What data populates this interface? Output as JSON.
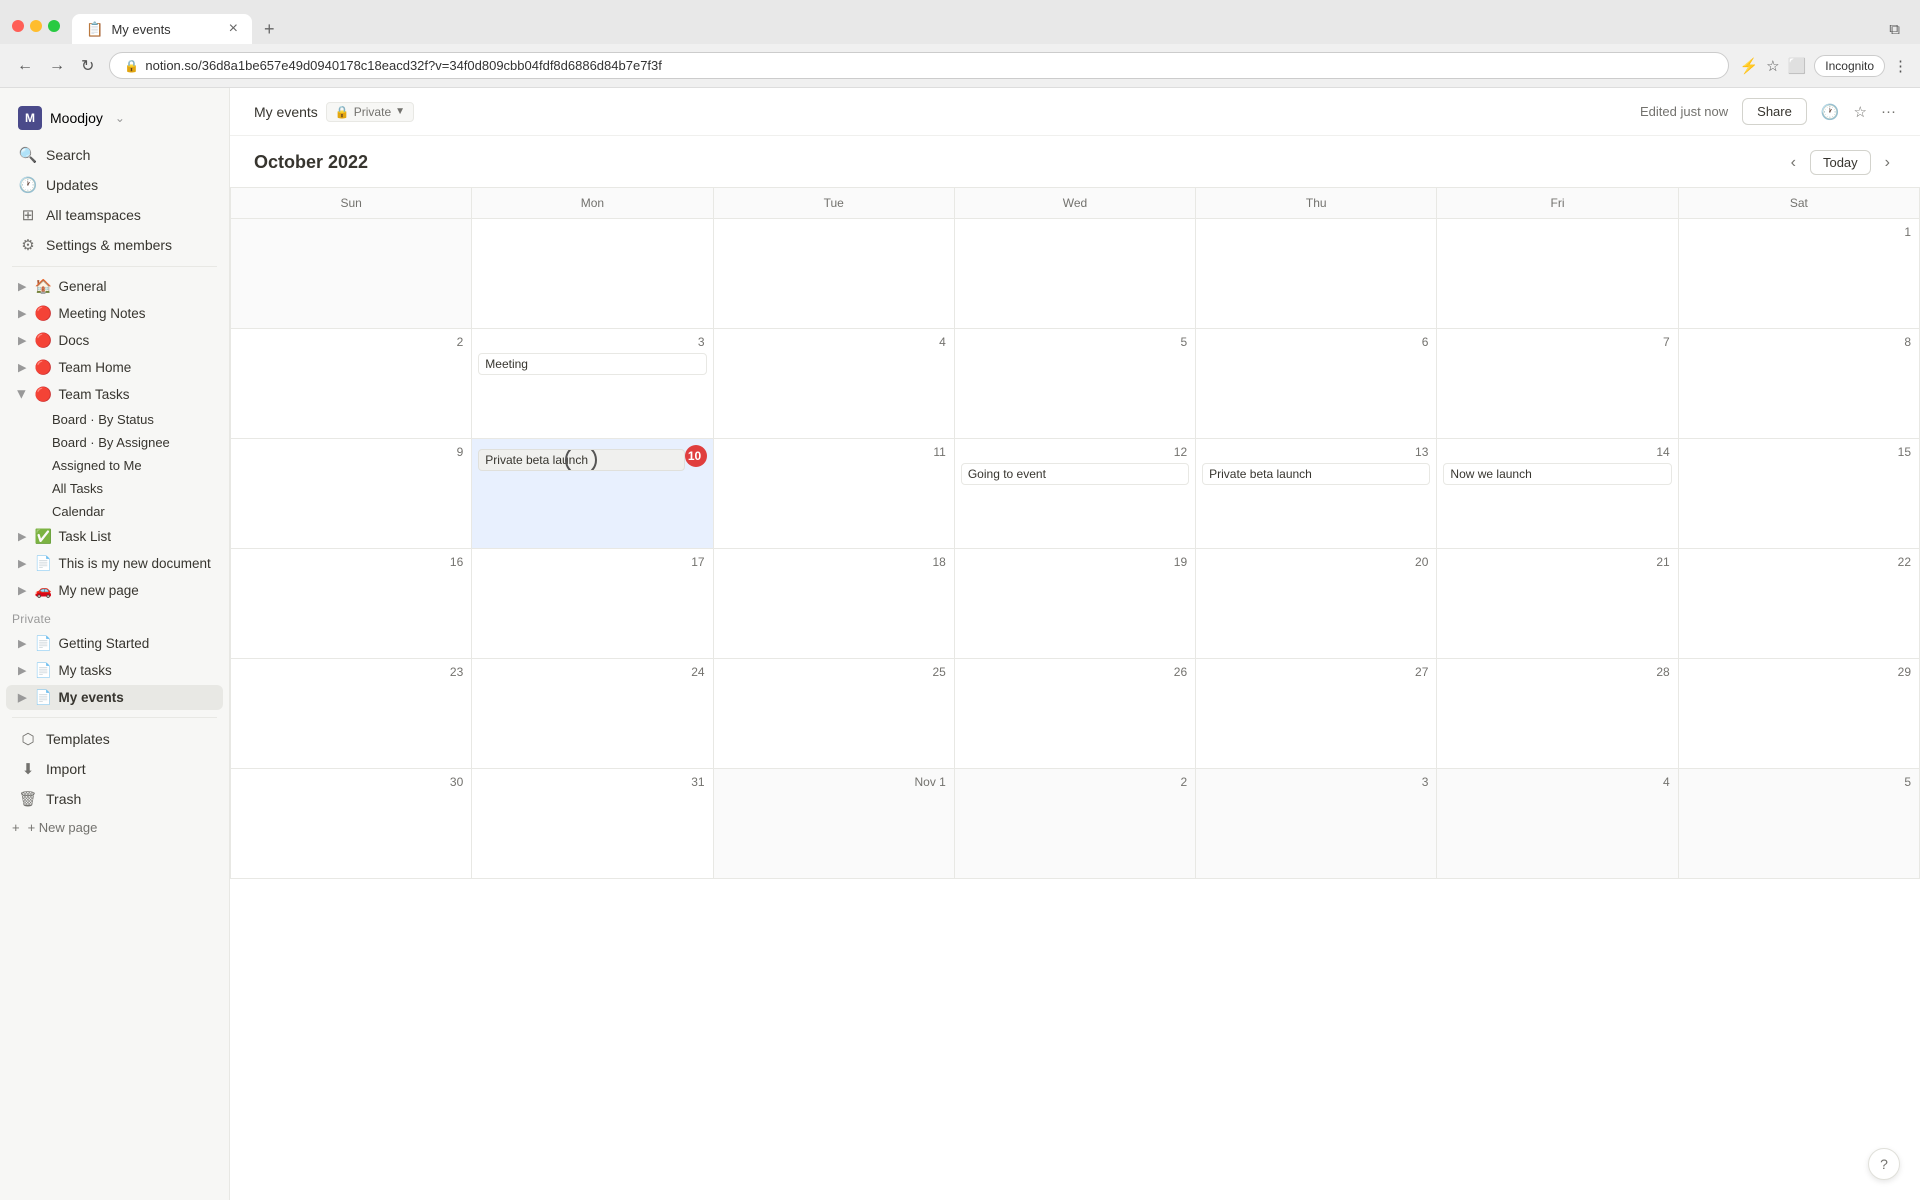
{
  "browser": {
    "tab_title": "My events",
    "tab_icon": "📋",
    "url": "notion.so/36d8a1be657e49d0940178c18eacd32f?v=34f0d809cbb04fdf8d6886d84b7e7f3f",
    "new_tab_label": "+",
    "back_btn": "←",
    "forward_btn": "→",
    "reload_btn": "↻",
    "lock_icon": "🔒",
    "incognito_label": "Incognito",
    "more_btn": "⋮"
  },
  "sidebar": {
    "workspace_name": "Moodjoy",
    "workspace_icon": "M",
    "search_label": "Search",
    "updates_label": "Updates",
    "all_teamspaces_label": "All teamspaces",
    "settings_label": "Settings & members",
    "general_label": "General",
    "general_icon": "🏠",
    "meeting_notes_label": "Meeting Notes",
    "docs_label": "Docs",
    "team_home_label": "Team Home",
    "team_tasks_label": "Team Tasks",
    "board_by_status_label": "Board · By Status",
    "board_by_assignee_label": "Board · By Assignee",
    "assigned_to_me_label": "Assigned to Me",
    "all_tasks_label": "All Tasks",
    "calendar_label": "Calendar",
    "task_list_label": "Task List",
    "new_document_label": "This is my new document",
    "my_new_page_label": "My new page",
    "private_label": "Private",
    "getting_started_label": "Getting Started",
    "my_tasks_label": "My tasks",
    "my_events_label": "My events",
    "templates_label": "Templates",
    "import_label": "Import",
    "trash_label": "Trash",
    "new_page_label": "+ New page"
  },
  "topbar": {
    "page_title": "My events",
    "privacy_label": "Private",
    "edited_label": "Edited just now",
    "share_label": "Share",
    "more_btn": "···"
  },
  "calendar": {
    "month_title": "October 2022",
    "today_btn": "Today",
    "nav_prev": "‹",
    "nav_next": "›",
    "days_of_week": [
      "Sun",
      "Mon",
      "Tue",
      "Wed",
      "Thu",
      "Fri",
      "Sat"
    ],
    "weeks": [
      [
        {
          "num": "",
          "other": true
        },
        {
          "num": "",
          "other": false
        },
        {
          "num": "",
          "other": false
        },
        {
          "num": "",
          "other": false
        },
        {
          "num": "",
          "other": false
        },
        {
          "num": "",
          "other": false
        },
        {
          "num": "1",
          "other": false
        }
      ],
      [
        {
          "num": "2",
          "other": false
        },
        {
          "num": "3",
          "other": false,
          "events": [
            "Meeting"
          ]
        },
        {
          "num": "4",
          "other": false
        },
        {
          "num": "5",
          "other": false
        },
        {
          "num": "6",
          "other": false
        },
        {
          "num": "7",
          "other": false
        },
        {
          "num": "8",
          "other": false
        }
      ],
      [
        {
          "num": "9",
          "other": false
        },
        {
          "num": "10",
          "other": false,
          "today": true,
          "highlighted": true,
          "events_grey": [
            "Private beta launch"
          ]
        },
        {
          "num": "11",
          "other": false
        },
        {
          "num": "12",
          "other": false,
          "events": [
            "Going to event"
          ]
        },
        {
          "num": "13",
          "other": false,
          "events": [
            "Private beta launch"
          ]
        },
        {
          "num": "14",
          "other": false,
          "events": [
            "Now we launch"
          ]
        },
        {
          "num": "15",
          "other": false
        }
      ],
      [
        {
          "num": "16",
          "other": false
        },
        {
          "num": "17",
          "other": false
        },
        {
          "num": "18",
          "other": false
        },
        {
          "num": "19",
          "other": false
        },
        {
          "num": "20",
          "other": false
        },
        {
          "num": "21",
          "other": false
        },
        {
          "num": "22",
          "other": false
        }
      ],
      [
        {
          "num": "23",
          "other": false
        },
        {
          "num": "24",
          "other": false
        },
        {
          "num": "25",
          "other": false
        },
        {
          "num": "26",
          "other": false
        },
        {
          "num": "27",
          "other": false
        },
        {
          "num": "28",
          "other": false
        },
        {
          "num": "29",
          "other": false
        }
      ],
      [
        {
          "num": "30",
          "other": false
        },
        {
          "num": "31",
          "other": false
        },
        {
          "num": "Nov 1",
          "other": true
        },
        {
          "num": "2",
          "other": true
        },
        {
          "num": "3",
          "other": true
        },
        {
          "num": "4",
          "other": true
        },
        {
          "num": "5",
          "other": true
        }
      ]
    ]
  }
}
